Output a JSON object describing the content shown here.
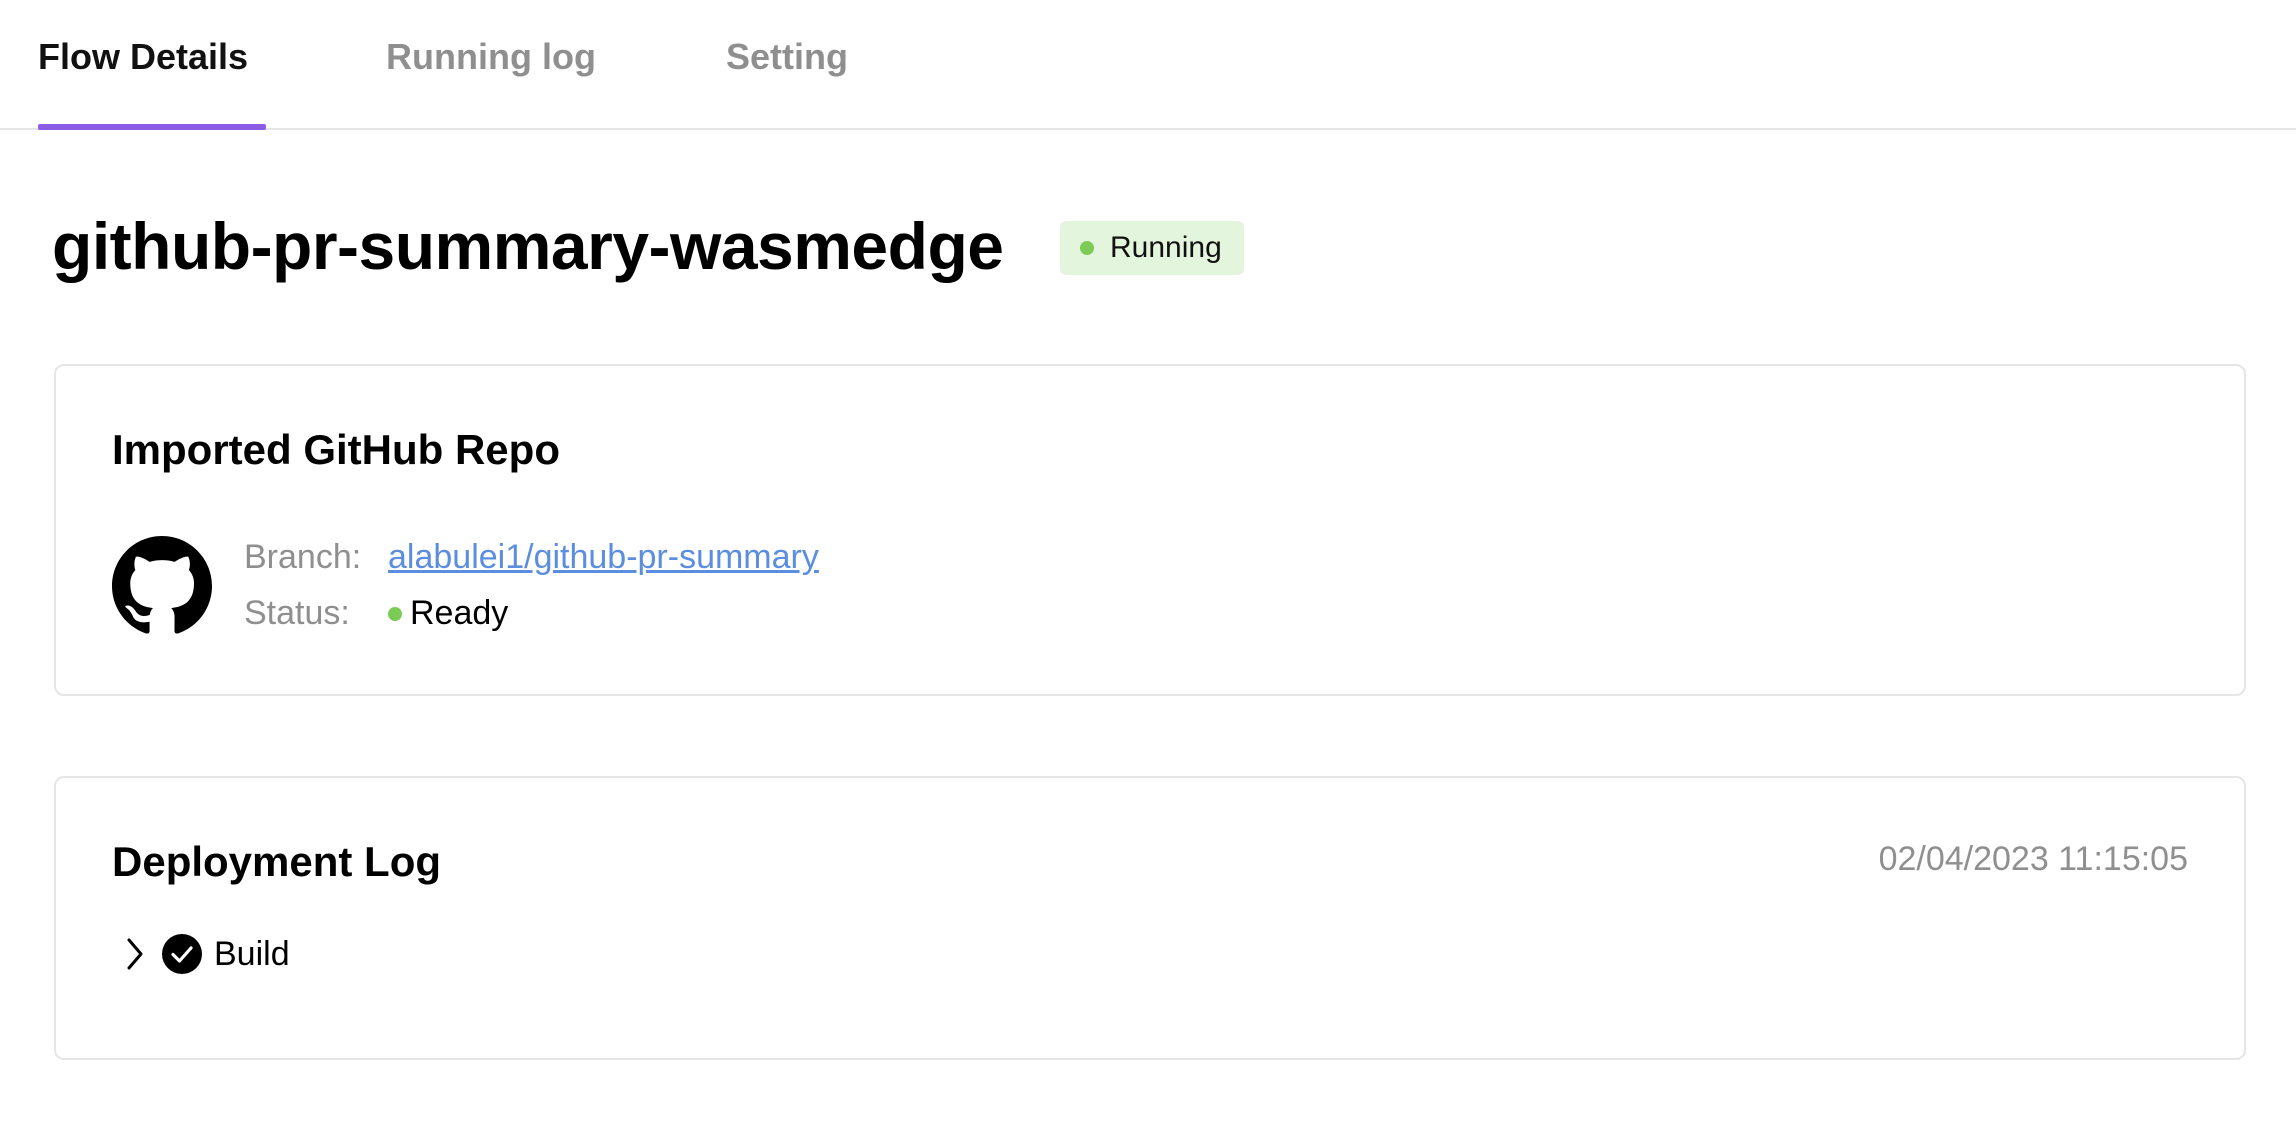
{
  "tabs": [
    {
      "label": "Flow Details",
      "active": true
    },
    {
      "label": "Running log",
      "active": false
    },
    {
      "label": "Setting",
      "active": false
    }
  ],
  "flow": {
    "name": "github-pr-summary-wasmedge",
    "status": "Running",
    "status_color": "#7dcb57"
  },
  "repo_card": {
    "title": "Imported GitHub Repo",
    "icon": "github-icon",
    "branch_label": "Branch:",
    "branch_value": "alabulei1/github-pr-summary",
    "status_label": "Status:",
    "status_value": "Ready",
    "status_color": "#7dcb57"
  },
  "deploy_card": {
    "title": "Deployment Log",
    "timestamp": "02/04/2023 11:15:05",
    "steps": [
      {
        "label": "Build",
        "state": "success",
        "icon": "check-circle-icon"
      }
    ]
  },
  "colors": {
    "accent": "#8c5ce6",
    "link": "#5b8de0",
    "badge_bg": "#e3f5dc"
  }
}
